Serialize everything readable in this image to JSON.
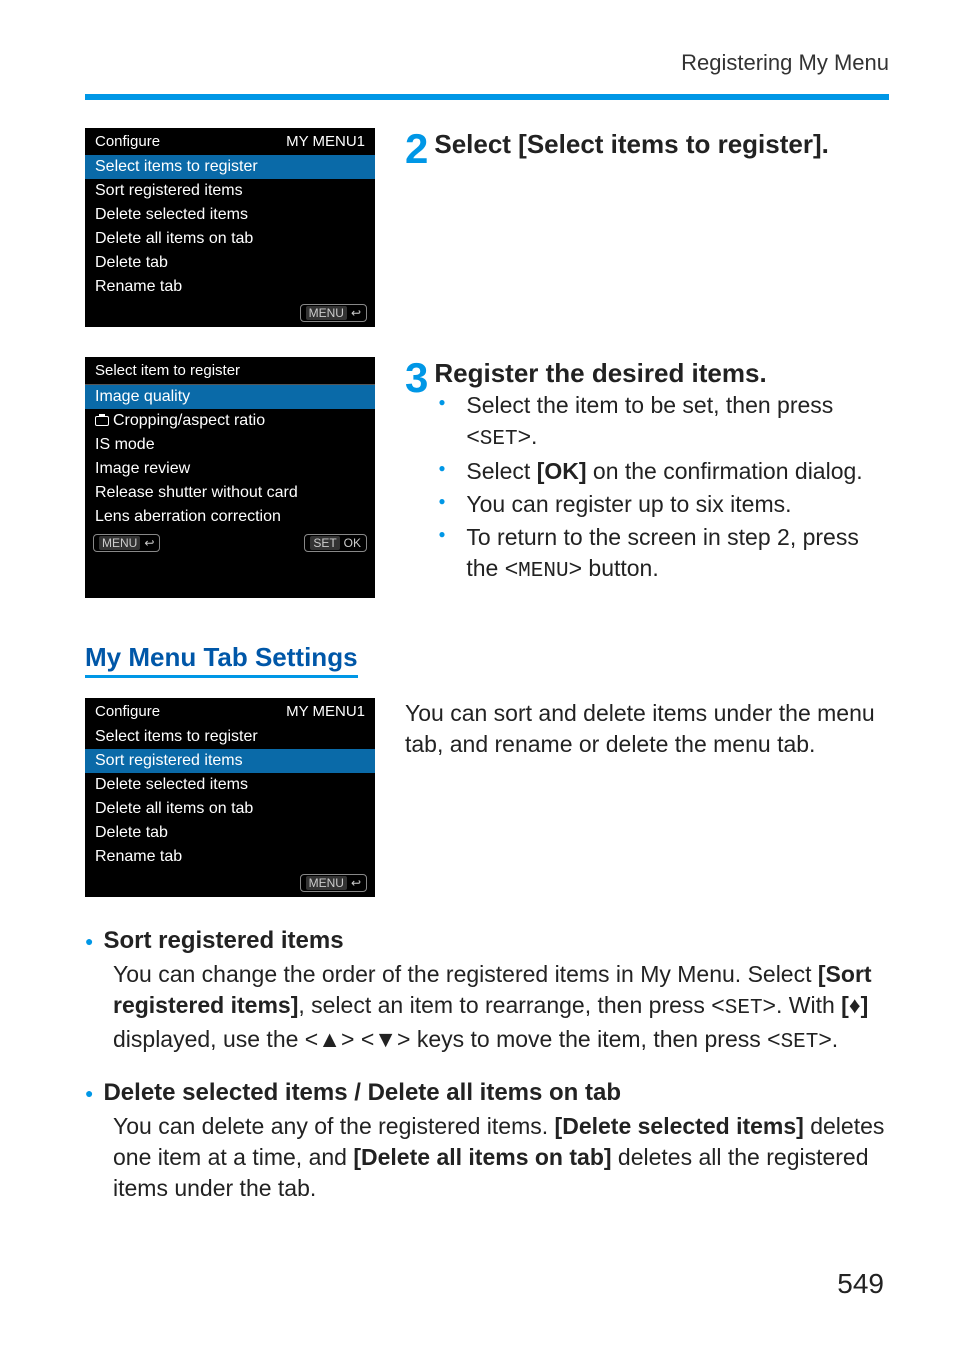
{
  "header": {
    "breadcrumb": "Registering My Menu"
  },
  "screenA": {
    "title_left": "Configure",
    "title_right": "MY MENU1",
    "items": [
      "Select items to register",
      "Sort registered items",
      "Delete selected items",
      "Delete all items on tab",
      "Delete tab",
      "Rename tab"
    ],
    "selected_index": 0,
    "foot_menu": "MENU",
    "foot_icon": "↩"
  },
  "screenB": {
    "title": "Select item to register",
    "items": [
      "Image quality",
      "Cropping/aspect ratio",
      "IS mode",
      "Image review",
      "Release shutter without card",
      "Lens aberration correction"
    ],
    "selected_index": 0,
    "camera_prefix_index": 1,
    "foot_left": "MENU",
    "foot_left_icon": "↩",
    "foot_right_set": "SET",
    "foot_right_ok": "OK"
  },
  "screenC": {
    "title_left": "Configure",
    "title_right": "MY MENU1",
    "items": [
      "Select items to register",
      "Sort registered items",
      "Delete selected items",
      "Delete all items on tab",
      "Delete tab",
      "Rename tab"
    ],
    "selected_index": 1,
    "foot_menu": "MENU",
    "foot_icon": "↩"
  },
  "step2": {
    "num": "2",
    "title": "Select [Select items to register]."
  },
  "step3": {
    "num": "3",
    "title": "Register the desired items.",
    "b1a": "Select the item to be set, then press <",
    "b1_set": "SET",
    "b1b": ">.",
    "b2a": "Select ",
    "b2_ok": "[OK]",
    "b2b": " on the confirmation dialog.",
    "b3": "You can register up to six items.",
    "b4a": "To return to the screen in step 2, press the <",
    "b4_menu": "MENU",
    "b4b": "> button."
  },
  "section_title": "My Menu Tab Settings",
  "section_para": "You can sort and delete items under the menu tab, and rename or delete the menu tab.",
  "sort": {
    "head": "Sort registered items",
    "p_a": "You can change the order of the registered items in My Menu. Select ",
    "p_bold1": "[Sort registered items]",
    "p_b": ", select an item to rearrange, then press <",
    "p_set1": "SET",
    "p_c": ">. With ",
    "p_bold2": "[",
    "p_arrow_ud": "♦",
    "p_bold2b": "]",
    "p_d": " displayed, use the <",
    "p_up": "▲",
    "p_e": "> <",
    "p_down": "▼",
    "p_f": "> keys to move the item, then press <",
    "p_set2": "SET",
    "p_g": ">."
  },
  "del": {
    "head": "Delete selected items / Delete all items on tab",
    "p_a": "You can delete any of the registered items. ",
    "p_bold1": "[Delete selected items]",
    "p_b": " deletes one item at a time, and ",
    "p_bold2": "[Delete all items on tab]",
    "p_c": " deletes all the registered items under the tab."
  },
  "page_number": "549"
}
